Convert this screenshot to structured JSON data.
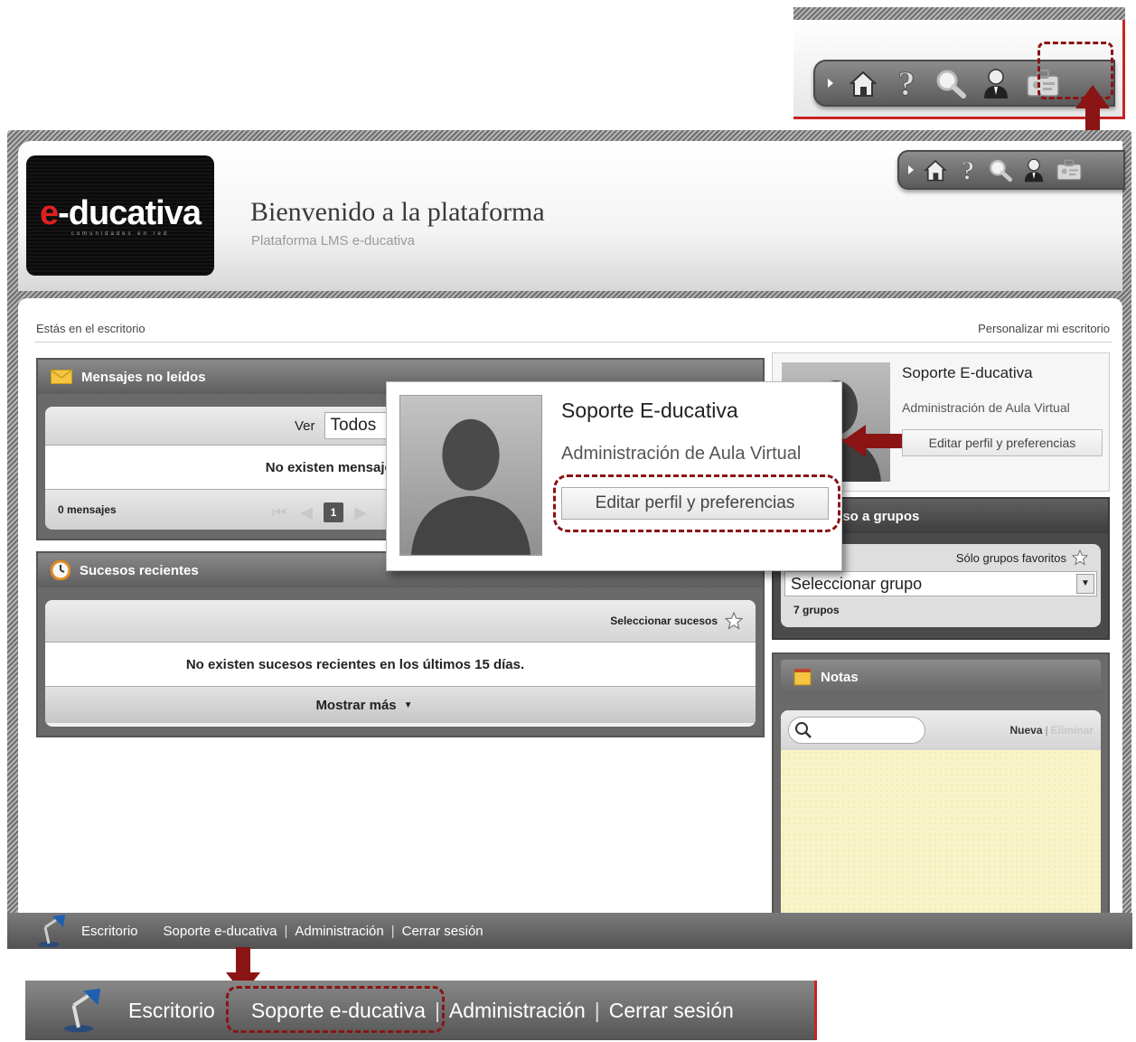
{
  "toolbar": {
    "icons": [
      "home-icon",
      "help-icon",
      "search-icon",
      "user-icon",
      "profile-card-icon"
    ]
  },
  "header": {
    "logo": {
      "brand": "e-ducativa",
      "prefix": "e",
      "word": "-ducativa",
      "tagline": "comunidades en red"
    },
    "title": "Bienvenido a la plataforma",
    "subtitle": "Plataforma LMS e-ducativa"
  },
  "breadcrumb": "Estás en el escritorio",
  "customize_link": "Personalizar mi escritorio",
  "messages": {
    "title": "Mensajes no leídos",
    "filter_label": "Ver",
    "filter_value": "Todos",
    "empty_text": "No existen mensajes",
    "count_text": "0 mensajes",
    "current_page": "1"
  },
  "events": {
    "title": "Sucesos recientes",
    "select_label": "Seleccionar sucesos",
    "empty_text": "No existen sucesos recientes en los últimos 15 días.",
    "more_label": "Mostrar más"
  },
  "profile": {
    "name": "Soporte E-ducativa",
    "role": "Administración de Aula Virtual",
    "edit_button": "Editar perfil y preferencias"
  },
  "groups": {
    "title_visible": "eso a grupos",
    "favorites_label": "Sólo grupos favoritos",
    "select_value": "Seleccionar grupo",
    "count_text": "7 grupos"
  },
  "notes": {
    "title": "Notas",
    "new_label": "Nueva",
    "separator": "|",
    "delete_label": "Eliminar"
  },
  "nav": {
    "items": [
      "Escritorio",
      "Soporte e-ducativa",
      "Administración",
      "Cerrar sesión"
    ],
    "separator": "|"
  },
  "colors": {
    "accent_red": "#8b1414",
    "frame_gray": "#6a6a6a",
    "notes_yellow": "#f8f4c8"
  }
}
